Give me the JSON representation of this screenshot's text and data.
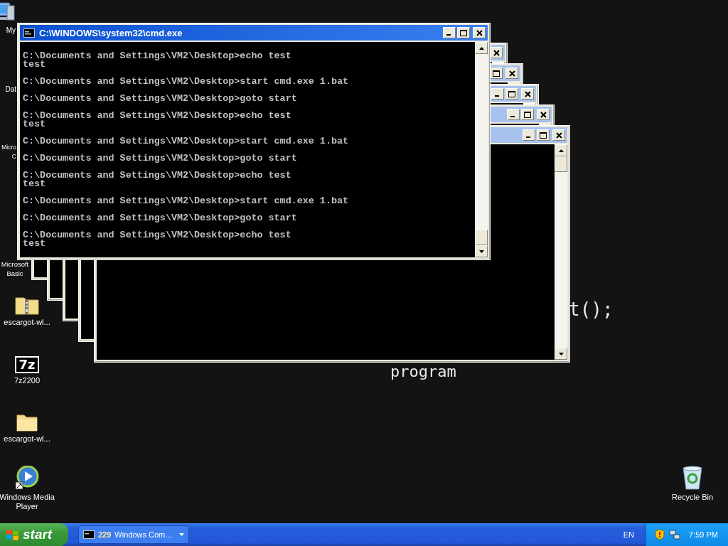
{
  "wallpaper_texts": [
    "t();",
    "program"
  ],
  "desktop_icons": [
    {
      "kind": "computer",
      "lines": [
        "My"
      ]
    },
    {
      "kind": "none",
      "lines": [
        "Dat"
      ]
    },
    {
      "kind": "none",
      "lines": [
        "Micro",
        "C"
      ]
    },
    {
      "kind": "none",
      "lines": [
        "Microsoft",
        "Basic"
      ]
    },
    {
      "kind": "zip-folder",
      "lines": [
        "escargot-wl..."
      ]
    },
    {
      "kind": "archive",
      "badge": "7z",
      "lines": [
        "7z2200"
      ]
    },
    {
      "kind": "folder",
      "lines": [
        "escargot-wl..."
      ]
    },
    {
      "kind": "media-player",
      "lines": [
        "Windows Media",
        "Player"
      ]
    },
    {
      "kind": "recycle-bin",
      "lines": [
        "Recycle Bin"
      ]
    }
  ],
  "windows": [
    {
      "active": false
    },
    {
      "active": false
    },
    {
      "active": false
    },
    {
      "active": false
    },
    {
      "active": false
    },
    {
      "active": true,
      "title": "C:\\WINDOWS\\system32\\cmd.exe",
      "console": [
        {
          "command": "C:\\Documents and Settings\\VM2\\Desktop>echo test",
          "output": "test"
        },
        {
          "command": "C:\\Documents and Settings\\VM2\\Desktop>start cmd.exe 1.bat"
        },
        {
          "command": "C:\\Documents and Settings\\VM2\\Desktop>goto start"
        },
        {
          "command": "C:\\Documents and Settings\\VM2\\Desktop>echo test",
          "output": "test"
        },
        {
          "command": "C:\\Documents and Settings\\VM2\\Desktop>start cmd.exe 1.bat"
        },
        {
          "command": "C:\\Documents and Settings\\VM2\\Desktop>goto start"
        },
        {
          "command": "C:\\Documents and Settings\\VM2\\Desktop>echo test",
          "output": "test"
        },
        {
          "command": "C:\\Documents and Settings\\VM2\\Desktop>start cmd.exe 1.bat"
        },
        {
          "command": "C:\\Documents and Settings\\VM2\\Desktop>goto start"
        },
        {
          "command": "C:\\Documents and Settings\\VM2\\Desktop>echo test",
          "output": "test"
        }
      ]
    }
  ],
  "taskbar": {
    "start": "start",
    "tasks": [
      {
        "count": "229",
        "label": "Windows Com...",
        "selected": false
      }
    ],
    "language": "EN",
    "clock": "7:59 PM"
  }
}
